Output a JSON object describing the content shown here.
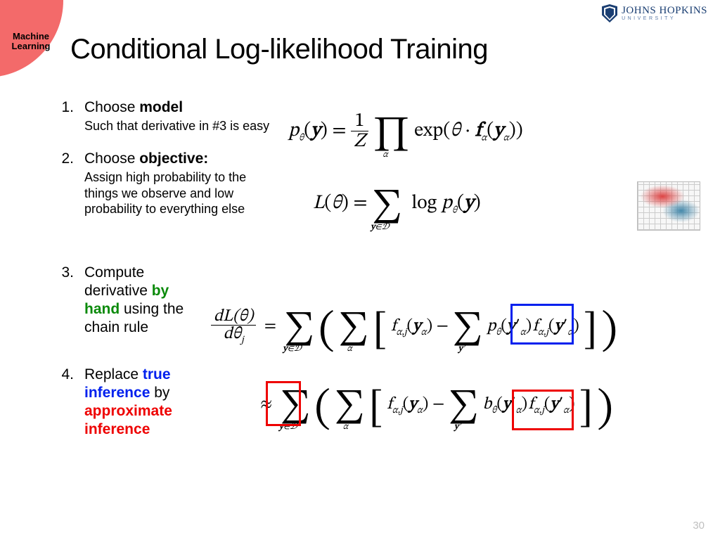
{
  "badge": {
    "line1": "Machine",
    "line2": "Learning"
  },
  "logo": {
    "top": "JOHNS HOPKINS",
    "bottom": "UNIVERSITY"
  },
  "title": "Conditional Log-likelihood Training",
  "steps": {
    "s1": {
      "head_a": "Choose ",
      "head_b": "model",
      "sub": "Such that derivative in #3 is easy"
    },
    "s2": {
      "head_a": "Choose ",
      "head_b": "objective:",
      "sub": "Assign high probability to the things we observe and low probability to everything else"
    },
    "s3": {
      "a": "Compute derivative ",
      "b": "by hand",
      "c": " using the chain rule"
    },
    "s4": {
      "a": "Replace ",
      "b": "true inference",
      "c": " by ",
      "d": "approximate inference"
    }
  },
  "equations": {
    "model": "p_θ(y) = (1/Z) ∏_α exp(θ · f_α(y_α))",
    "objective": "L(θ) = Σ_{y∈D} log p_θ(y)",
    "gradient": "dL(θ)/dθ_j = Σ_{y∈D} ( Σ_α [ f_{α,j}(y_α) − Σ_{y'} p_θ(y'_α) f_{α,j}(y'_α) ] )",
    "approx": "≈ Σ_{y∈D} ( Σ_α [ f_{α,j}(y_α) − Σ_{y'} b_θ(y'_α) f_{α,j}(y'_α) ] )"
  },
  "highlights": {
    "exact_term": "p_θ(y'_α)",
    "approx_sum": "Σ_{y∈D}",
    "approx_term": "b_θ(y'_α)"
  },
  "page_number": "30"
}
